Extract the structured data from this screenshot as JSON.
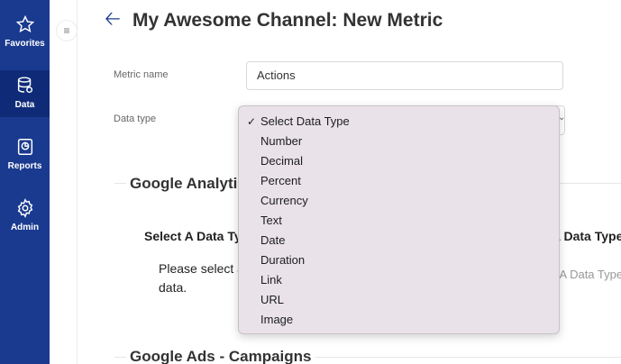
{
  "sidebar": {
    "items": [
      {
        "label": "Favorites",
        "icon": "star-icon"
      },
      {
        "label": "Data",
        "icon": "database-icon",
        "active": true
      },
      {
        "label": "Reports",
        "icon": "report-icon"
      },
      {
        "label": "Admin",
        "icon": "gear-icon"
      }
    ]
  },
  "header": {
    "title": "My Awesome Channel: New Metric"
  },
  "form": {
    "metric_name_label": "Metric name",
    "metric_name_value": "Actions",
    "data_type_label": "Data type"
  },
  "sections": {
    "google_analytics_title": "Google Analytics",
    "select_data_type_heading": "Select A Data Type",
    "select_data_type_heading_right": "A Data Type",
    "instruction_line1": "Please select a data type",
    "instruction_line2": "data.",
    "right_placeholder": "t A Data Type",
    "google_ads_title": "Google Ads - Campaigns"
  },
  "dropdown": {
    "selected": "Select Data Type",
    "options": [
      "Select Data Type",
      "Number",
      "Decimal",
      "Percent",
      "Currency",
      "Text",
      "Date",
      "Duration",
      "Link",
      "URL",
      "Image"
    ]
  },
  "colors": {
    "sidebar": "#1a3a8f",
    "sidebar_active": "#0f2b78",
    "dropdown_bg": "#e9e3e9"
  }
}
